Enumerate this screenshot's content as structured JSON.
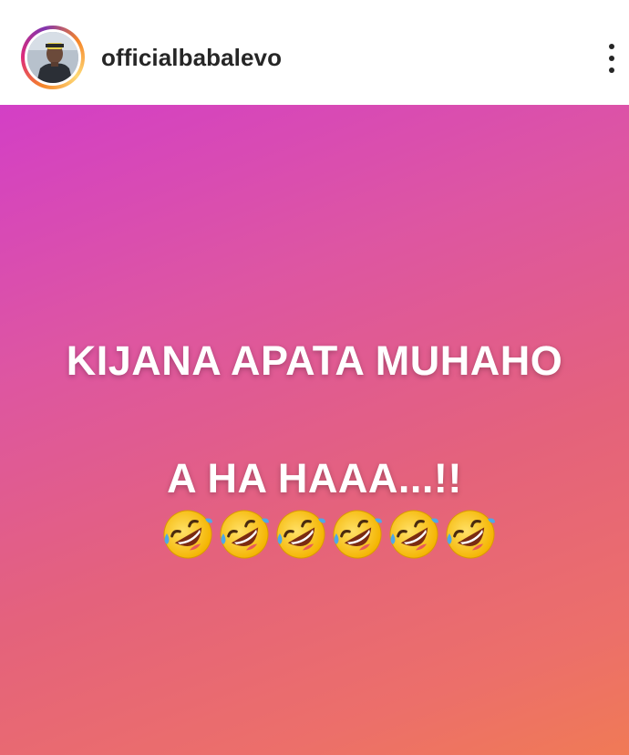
{
  "header": {
    "username": "officialbabalevo",
    "avatar_icon": "profile-photo-avatar",
    "more_icon": "more-vertical-icon"
  },
  "post": {
    "line1": "KIJANA APATA MUHAHO",
    "line2": "A HA HAAA...!!",
    "emoji_icon": "rolling-on-floor-laughing-emoji",
    "emoji_count": 6,
    "background_colors": [
      "#d33fc6",
      "#e4627c",
      "#f07a56"
    ]
  }
}
